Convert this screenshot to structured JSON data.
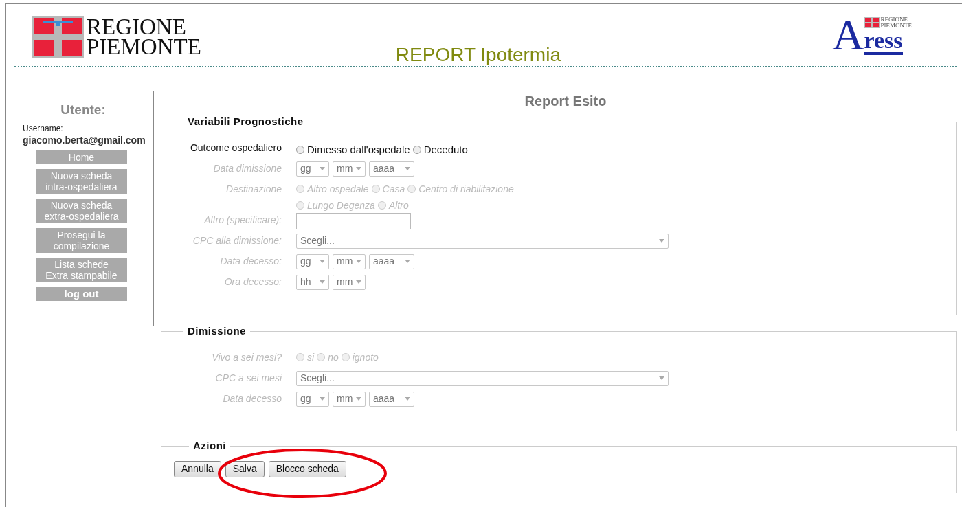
{
  "header": {
    "logo_line1": "REGIONE",
    "logo_line2": "PIEMONTE",
    "title": "REPORT Ipotermia",
    "partner_logo": {
      "letter": "A",
      "word": "ress",
      "small_line1": "REGIONE",
      "small_line2": "PIEMONTE"
    }
  },
  "sidebar": {
    "heading": "Utente:",
    "username_label": "Username:",
    "username": "giacomo.berta@gmail.com",
    "menu": [
      {
        "label": "Home",
        "bold": false
      },
      {
        "label": "Nuova scheda\nintra-ospedaliera",
        "bold": false
      },
      {
        "label": "Nuova scheda\nextra-ospedaliera",
        "bold": false
      },
      {
        "label": "Prosegui la\ncompilazione",
        "bold": false
      },
      {
        "label": "Lista schede\nExtra stampabile",
        "bold": false
      },
      {
        "label": "log out",
        "bold": true
      }
    ]
  },
  "page_title": "Report Esito",
  "sections": [
    {
      "legend": "Variabili Prognostiche",
      "fields": [
        {
          "kind": "radio",
          "label": "Outcome ospedaliero",
          "disabled": false,
          "options": [
            {
              "label": "Dimesso dall'ospedale",
              "checked": false
            },
            {
              "label": "Deceduto",
              "checked": false
            }
          ]
        },
        {
          "kind": "date",
          "label": "Data dimissione",
          "disabled": true,
          "selects": [
            "gg",
            "mm",
            "aaaa"
          ]
        },
        {
          "kind": "radio",
          "label": "Destinazione",
          "disabled": true,
          "options": [
            {
              "label": "Altro ospedale",
              "checked": false
            },
            {
              "label": "Casa",
              "checked": false
            },
            {
              "label": "Centro di riabilitazione",
              "checked": false
            },
            {
              "label": "Lungo Degenza",
              "checked": false
            },
            {
              "label": "Altro",
              "checked": false
            }
          ]
        },
        {
          "kind": "text",
          "label": "Altro (specificare):",
          "disabled": true
        },
        {
          "kind": "select",
          "label": "CPC alla dimissione:",
          "disabled": true,
          "value": "Scegli..."
        },
        {
          "kind": "date",
          "label": "Data decesso:",
          "disabled": true,
          "selects": [
            "gg",
            "mm",
            "aaaa"
          ]
        },
        {
          "kind": "date",
          "label": "Ora decesso:",
          "disabled": true,
          "selects": [
            "hh",
            "mm"
          ]
        }
      ]
    },
    {
      "legend": "Dimissione",
      "fields": [
        {
          "kind": "radio",
          "label": "Vivo a sei mesi?",
          "disabled": true,
          "options": [
            {
              "label": "si",
              "checked": false
            },
            {
              "label": "no",
              "checked": false
            },
            {
              "label": "ignoto",
              "checked": false
            }
          ]
        },
        {
          "kind": "select",
          "label": "CPC a sei mesi",
          "disabled": true,
          "value": "Scegli..."
        },
        {
          "kind": "date",
          "label": "Data decesso",
          "disabled": true,
          "selects": [
            "gg",
            "mm",
            "aaaa"
          ]
        }
      ]
    }
  ],
  "actions": {
    "legend": "Azioni",
    "buttons": [
      "Annulla",
      "Salva",
      "Blocco scheda"
    ]
  }
}
